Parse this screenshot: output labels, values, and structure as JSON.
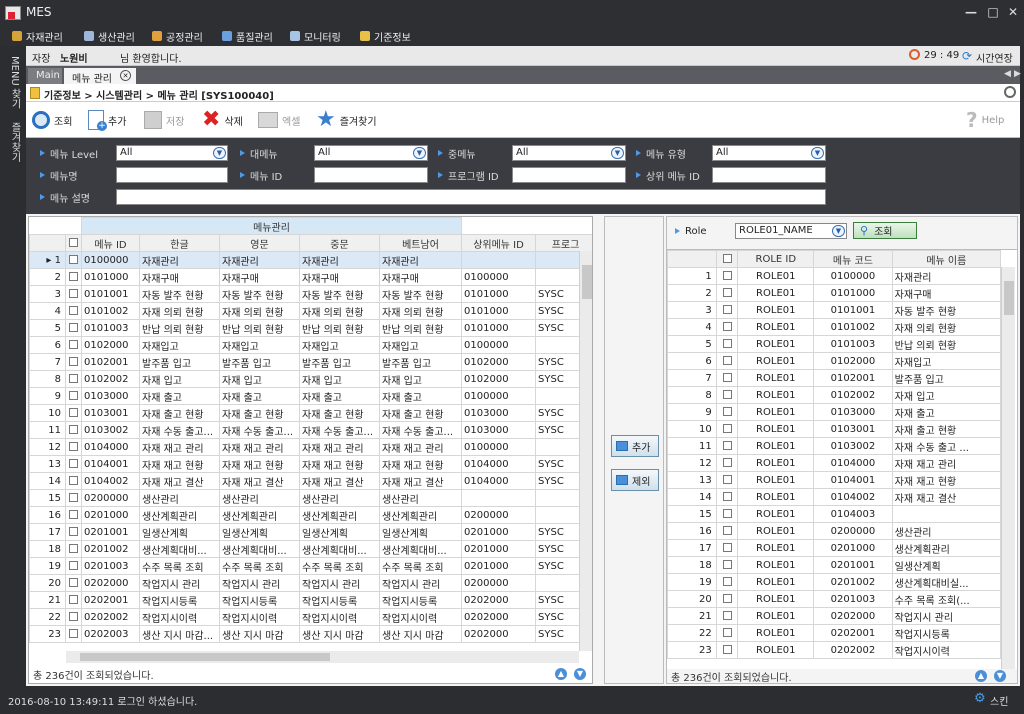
{
  "window": {
    "title": "MES"
  },
  "menubar": [
    "자재관리",
    "생산관리",
    "공정관리",
    "품질관리",
    "모니터링",
    "기준정보"
  ],
  "sidebar": [
    "MENU 찾기",
    "즐겨찾기"
  ],
  "userbar": {
    "role_label": "자장",
    "user_name": "노원비",
    "greeting": "님 환영합니다.",
    "timer": "29 : 49",
    "extend_label": "시간연장"
  },
  "tabs": [
    "Main",
    "메뉴 관리"
  ],
  "breadcrumb": "기준정보 > 시스템관리 > 메뉴 관리 [SYS100040]",
  "toolbar": {
    "search": "조회",
    "add": "추가",
    "save": "저장",
    "delete": "삭제",
    "excel": "엑셀",
    "favorite": "즐겨찾기",
    "help": "Help"
  },
  "filters": {
    "menu_level": {
      "label": "메뉴 Level",
      "value": "All"
    },
    "major_menu": {
      "label": "대메뉴",
      "value": "All"
    },
    "middle_menu": {
      "label": "중메뉴",
      "value": "All"
    },
    "menu_type": {
      "label": "메뉴 유형",
      "value": "All"
    },
    "menu_name": {
      "label": "메뉴명",
      "value": ""
    },
    "menu_id": {
      "label": "메뉴 ID",
      "value": ""
    },
    "program_id": {
      "label": "프로그램 ID",
      "value": ""
    },
    "parent_menu_id": {
      "label": "상위 메뉴 ID",
      "value": ""
    },
    "menu_desc": {
      "label": "메뉴 설명",
      "value": ""
    }
  },
  "left_grid": {
    "group_header": "메뉴관리",
    "columns": [
      "메뉴 ID",
      "한글",
      "영문",
      "중문",
      "베트남어",
      "상위메뉴 ID",
      "프로그"
    ],
    "rows": [
      [
        "0100000",
        "자재관리",
        "자재관리",
        "자재관리",
        "자재관리",
        "",
        ""
      ],
      [
        "0101000",
        "자재구매",
        "자재구매",
        "자재구매",
        "자재구매",
        "0100000",
        ""
      ],
      [
        "0101001",
        "자동 발주 현황",
        "자동 발주 현황",
        "자동 발주 현황",
        "자동 발주 현황",
        "0101000",
        "SYSC"
      ],
      [
        "0101002",
        "자재 의뢰 현황",
        "자재 의뢰 현황",
        "자재 의뢰 현황",
        "자재 의뢰 현황",
        "0101000",
        "SYSC"
      ],
      [
        "0101003",
        "반납 의뢰 현황",
        "반납 의뢰 현황",
        "반납 의뢰 현황",
        "반납 의뢰 현황",
        "0101000",
        "SYSC"
      ],
      [
        "0102000",
        "자재입고",
        "자재입고",
        "자재입고",
        "자재입고",
        "0100000",
        ""
      ],
      [
        "0102001",
        "발주품 입고",
        "발주품 입고",
        "발주품 입고",
        "발주품 입고",
        "0102000",
        "SYSC"
      ],
      [
        "0102002",
        "자재 입고",
        "자재 입고",
        "자재 입고",
        "자재 입고",
        "0102000",
        "SYSC"
      ],
      [
        "0103000",
        "자재 출고",
        "자재 출고",
        "자재 출고",
        "자재 출고",
        "0100000",
        ""
      ],
      [
        "0103001",
        "자재 출고 현황",
        "자재 출고 현황",
        "자재 출고 현황",
        "자재 출고 현황",
        "0103000",
        "SYSC"
      ],
      [
        "0103002",
        "자재 수동 출고...",
        "자재 수동 출고...",
        "자재 수동 출고...",
        "자재 수동 출고...",
        "0103000",
        "SYSC"
      ],
      [
        "0104000",
        "자재 재고 관리",
        "자재 재고 관리",
        "자재 재고 관리",
        "자재 재고 관리",
        "0100000",
        ""
      ],
      [
        "0104001",
        "자재 재고 현황",
        "자재 재고 현황",
        "자재 재고 현황",
        "자재 재고 현황",
        "0104000",
        "SYSC"
      ],
      [
        "0104002",
        "자재 재고 결산",
        "자재 재고 결산",
        "자재 재고 결산",
        "자재 재고 결산",
        "0104000",
        "SYSC"
      ],
      [
        "0200000",
        "생산관리",
        "생산관리",
        "생산관리",
        "생산관리",
        "",
        ""
      ],
      [
        "0201000",
        "생산계획관리",
        "생산계획관리",
        "생산계획관리",
        "생산계획관리",
        "0200000",
        ""
      ],
      [
        "0201001",
        "일생산계획",
        "일생산계획",
        "일생산계획",
        "일생산계획",
        "0201000",
        "SYSC"
      ],
      [
        "0201002",
        "생산계획대비...",
        "생산계획대비...",
        "생산계획대비...",
        "생산계획대비...",
        "0201000",
        "SYSC"
      ],
      [
        "0201003",
        "수주 목록 조회",
        "수주 목록 조회",
        "수주 목록 조회",
        "수주 목록 조회",
        "0201000",
        "SYSC"
      ],
      [
        "0202000",
        "작업지시 관리",
        "작업지시 관리",
        "작업지시 관리",
        "작업지시 관리",
        "0200000",
        ""
      ],
      [
        "0202001",
        "작업지시등록",
        "작업지시등록",
        "작업지시등록",
        "작업지시등록",
        "0202000",
        "SYSC"
      ],
      [
        "0202002",
        "작업지시이력",
        "작업지시이력",
        "작업지시이력",
        "작업지시이력",
        "0202000",
        "SYSC"
      ],
      [
        "0202003",
        "생산 지시 마감...",
        "생산 지시 마감",
        "생산 지시 마감",
        "생산 지시 마감",
        "0202000",
        "SYSC"
      ]
    ],
    "status": "총 236건이 조회되었습니다."
  },
  "middle": {
    "add_label": "추가",
    "remove_label": "제외"
  },
  "right": {
    "role_label": "Role",
    "role_value": "ROLE01_NAME",
    "search_label": "조회",
    "columns": [
      "ROLE ID",
      "메뉴 코드",
      "메뉴 이름"
    ],
    "rows": [
      [
        "ROLE01",
        "0100000",
        "자재관리"
      ],
      [
        "ROLE01",
        "0101000",
        "자재구매"
      ],
      [
        "ROLE01",
        "0101001",
        "자동 발주 현황"
      ],
      [
        "ROLE01",
        "0101002",
        "자재 의뢰 현황"
      ],
      [
        "ROLE01",
        "0101003",
        "반납 의뢰 현황"
      ],
      [
        "ROLE01",
        "0102000",
        "자재입고"
      ],
      [
        "ROLE01",
        "0102001",
        "발주품 입고"
      ],
      [
        "ROLE01",
        "0102002",
        "자재 입고"
      ],
      [
        "ROLE01",
        "0103000",
        "자재 출고"
      ],
      [
        "ROLE01",
        "0103001",
        "자재 출고 현황"
      ],
      [
        "ROLE01",
        "0103002",
        "자재 수동 출고 ..."
      ],
      [
        "ROLE01",
        "0104000",
        "자재 재고 관리"
      ],
      [
        "ROLE01",
        "0104001",
        "자재 재고 현황"
      ],
      [
        "ROLE01",
        "0104002",
        "자재 재고 결산"
      ],
      [
        "ROLE01",
        "0104003",
        ""
      ],
      [
        "ROLE01",
        "0200000",
        "생산관리"
      ],
      [
        "ROLE01",
        "0201000",
        "생산계획관리"
      ],
      [
        "ROLE01",
        "0201001",
        "일생산계획"
      ],
      [
        "ROLE01",
        "0201002",
        "생산계획대비실..."
      ],
      [
        "ROLE01",
        "0201003",
        "수주 목록 조회(..."
      ],
      [
        "ROLE01",
        "0202000",
        "작업지시 관리"
      ],
      [
        "ROLE01",
        "0202001",
        "작업지시등록"
      ],
      [
        "ROLE01",
        "0202002",
        "작업지시이력"
      ]
    ],
    "status": "총 236건이 조회되었습니다."
  },
  "bottom": {
    "login_text": "2016-08-10 13:49:11 로그인 하셨습니다.",
    "skin_label": "스킨"
  }
}
